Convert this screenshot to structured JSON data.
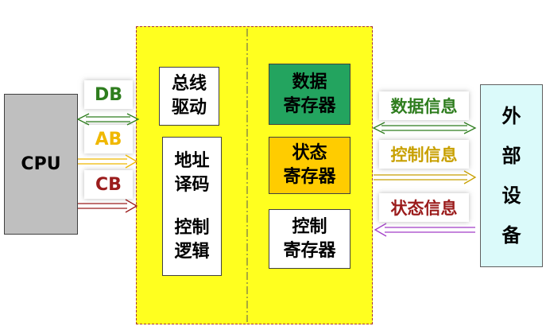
{
  "cpu": {
    "label": "CPU"
  },
  "buses": {
    "db": {
      "label": "DB",
      "color": "#2e7d1e"
    },
    "ab": {
      "label": "AB",
      "color": "#f0b800"
    },
    "cb": {
      "label": "CB",
      "color": "#9b1c1c"
    }
  },
  "interface": {
    "bus_driver": {
      "line1": "总线",
      "line2": "驱动"
    },
    "decode_logic": {
      "line1": "地址",
      "line2": "译码",
      "line3": "控制",
      "line4": "逻辑"
    },
    "data_register": {
      "line1": "数据",
      "line2": "寄存器",
      "fill": "#23a45f"
    },
    "status_register": {
      "line1": "状态",
      "line2": "寄存器",
      "fill": "#ffcc00"
    },
    "control_register": {
      "line1": "控制",
      "line2": "寄存器",
      "fill": "#ffffff"
    }
  },
  "signals": {
    "data": {
      "label": "数据信息",
      "color": "#2e7d1e"
    },
    "control": {
      "label": "控制信息",
      "color": "#c8a000"
    },
    "status": {
      "label": "状态信息",
      "color": "#9b1c1c"
    }
  },
  "device": {
    "chars": [
      "外",
      "部",
      "设",
      "备"
    ]
  }
}
